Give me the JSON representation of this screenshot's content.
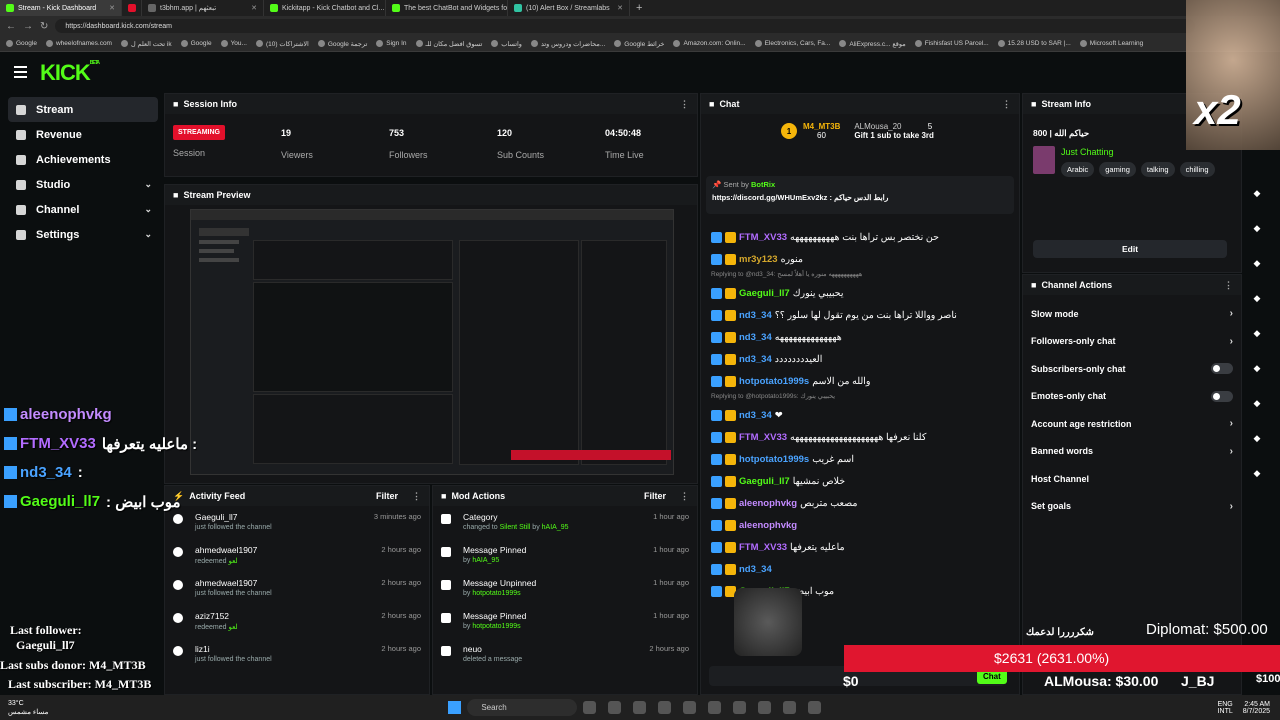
{
  "browser": {
    "tabs": [
      {
        "title": "Stream - Kick Dashboard",
        "color": "#53fc18",
        "active": true
      },
      {
        "title": "",
        "color": "#e3102b"
      },
      {
        "title": "t3bhm.app | تبعثهم",
        "color": "#666"
      },
      {
        "title": "Kickitapp - Kick Chatbot and Cl...",
        "color": "#53fc18"
      },
      {
        "title": "The best ChatBot and Widgets fo...",
        "color": "#53fc18"
      },
      {
        "title": "(10) Alert Box / Streamlabs",
        "color": "#31c3a2"
      }
    ],
    "url": "https://dashboard.kick.com/stream",
    "bookmarks": [
      "Google",
      "wheelofnames.com",
      "تحت العلم ل ik",
      "Google",
      "You...",
      "الاشتراكات (10)",
      "Google ترجمة",
      "Sign In",
      "تسوق افضل مكان للـ",
      "واتساب",
      "محاضرات ودروس وتد...",
      "Google خرائط",
      "Amazon.com: Onlin...",
      "Electronics, Cars, Fa...",
      "AliExpress.c... موقع",
      "Fishisfast US Parcel...",
      "15.28 USD to SAR |...",
      "Microsoft Learning"
    ]
  },
  "sidebar": {
    "logo": "KICK",
    "logo_badge": "BETA",
    "items": [
      {
        "label": "Stream",
        "icon": "stream-icon",
        "active": true
      },
      {
        "label": "Revenue",
        "icon": "revenue-icon"
      },
      {
        "label": "Achievements",
        "icon": "trophy-icon"
      },
      {
        "label": "Studio",
        "icon": "gear-icon",
        "chev": "⌄"
      },
      {
        "label": "Channel",
        "icon": "channel-icon",
        "chev": "⌄"
      },
      {
        "label": "Settings",
        "icon": "settings-icon",
        "chev": "⌄"
      }
    ]
  },
  "session": {
    "title": "Session Info",
    "status": "STREAMING",
    "status_label": "Session",
    "stats": [
      {
        "value": "19",
        "label": "Viewers"
      },
      {
        "value": "753",
        "label": "Followers"
      },
      {
        "value": "120",
        "label": "Sub Counts"
      },
      {
        "value": "04:50:48",
        "label": "Time Live"
      }
    ]
  },
  "preview": {
    "title": "Stream Preview"
  },
  "activity": {
    "title": "Activity Feed",
    "filter": "Filter",
    "items": [
      {
        "user": "Gaeguli_ll7",
        "sub": "just followed the channel",
        "time": "3 minutes ago",
        "kind": "follow"
      },
      {
        "user": "ahmedwael1907",
        "sub": "redeemed",
        "reward": "لعو",
        "time": "2 hours ago",
        "kind": "redeem"
      },
      {
        "user": "ahmedwael1907",
        "sub": "just followed the channel",
        "time": "2 hours ago",
        "kind": "follow"
      },
      {
        "user": "aziz7152",
        "sub": "redeemed",
        "reward": "لعو",
        "time": "2 hours ago",
        "kind": "redeem"
      },
      {
        "user": "liz1i",
        "sub": "just followed the channel",
        "time": "2 hours ago",
        "kind": "follow"
      }
    ]
  },
  "mod": {
    "title": "Mod Actions",
    "filter": "Filter",
    "items": [
      {
        "action": "Category",
        "detail": "changed to",
        "target": "Silent Still",
        "by": "by",
        "who": "hAIA_95",
        "time": "1 hour ago"
      },
      {
        "action": "Message Pinned",
        "detail": "",
        "target": "",
        "by": "by",
        "who": "hAIA_95",
        "time": "1 hour ago"
      },
      {
        "action": "Message Unpinned",
        "detail": "",
        "target": "",
        "by": "by",
        "who": "hotpotato1999s",
        "time": "1 hour ago"
      },
      {
        "action": "Message Pinned",
        "detail": "",
        "target": "",
        "by": "by",
        "who": "hotpotato1999s",
        "time": "1 hour ago"
      },
      {
        "action": "neuo",
        "detail": "deleted a message",
        "target": "",
        "by": "",
        "who": "",
        "time": "2 hours ago"
      }
    ]
  },
  "chat": {
    "title": "Chat",
    "gifter": {
      "name": "M4_MT3B",
      "count": "60",
      "rank": "1"
    },
    "gifter2": {
      "name": "ALMousa_20",
      "count": "5",
      "goal": "Gift 1 sub to take 3rd"
    },
    "pinned": {
      "sent_by": "Sent by",
      "bot": "BotRix",
      "text": "رابط الدس حياكم : https://discord.gg/WHUmExv2kz"
    },
    "messages": [
      {
        "name": "FTM_XV33",
        "color": "#b26cff",
        "text": "حن نختصر بس تراها بنت ههههههههههه",
        "reply": ""
      },
      {
        "name": "mr3y123",
        "color": "#d4a72c",
        "text": "منوره",
        "reply": ""
      },
      {
        "name": "Gaeguli_ll7",
        "color": "#53fc18",
        "text": "يحبيبي ينورك",
        "reply": "Replying to @nd3_34: ههههههههههه منوره يا أهلاً لمسح"
      },
      {
        "name": "nd3_34",
        "color": "#4aa3ff",
        "text": "ناصر وواللا تراها بنت من يوم تقول لها سلور ؟؟",
        "reply": ""
      },
      {
        "name": "nd3_34",
        "color": "#4aa3ff",
        "text": "ههههههههههههههه",
        "reply": ""
      },
      {
        "name": "nd3_34",
        "color": "#4aa3ff",
        "text": "العيدددددددد",
        "reply": ""
      },
      {
        "name": "hotpotato1999s",
        "color": "#4aa3ff",
        "text": "والله من الاسم",
        "reply": ""
      },
      {
        "name": "nd3_34",
        "color": "#4aa3ff",
        "text": "❤",
        "reply": "Replying to @hotpotato1999s: يحبيبي ينورك"
      },
      {
        "name": "FTM_XV33",
        "color": "#b26cff",
        "text": "كلنا نعرفها ههههههههههههههههههههه",
        "reply": ""
      },
      {
        "name": "hotpotato1999s",
        "color": "#4aa3ff",
        "text": "اسم غريب",
        "reply": ""
      },
      {
        "name": "Gaeguli_ll7",
        "color": "#53fc18",
        "text": "خلاص نمشيها",
        "reply": ""
      },
      {
        "name": "aleenophvkg",
        "color": "#c38bff",
        "text": "مصعب متربص",
        "reply": ""
      },
      {
        "name": "aleenophvkg",
        "color": "#c38bff",
        "text": "",
        "reply": ""
      },
      {
        "name": "FTM_XV33",
        "color": "#b26cff",
        "text": "ماعليه يتعرفها",
        "reply": ""
      },
      {
        "name": "nd3_34",
        "color": "#4aa3ff",
        "text": "",
        "reply": ""
      },
      {
        "name": "Gaeguli_ll7",
        "color": "#53fc18",
        "text": "موب ابيض",
        "reply": ""
      }
    ],
    "send": "Chat"
  },
  "streaminfo": {
    "title": "Stream Info",
    "stream_title": "800 | حياكم الله",
    "category": "Just Chatting",
    "tags": [
      "Arabic",
      "gaming",
      "talking",
      "chilling"
    ],
    "edit": "Edit"
  },
  "actions": {
    "title": "Channel Actions",
    "items": [
      {
        "label": "Slow mode",
        "type": "chev"
      },
      {
        "label": "Followers-only chat",
        "type": "chev"
      },
      {
        "label": "Subscribers-only chat",
        "type": "toggle"
      },
      {
        "label": "Emotes-only chat",
        "type": "toggle"
      },
      {
        "label": "Account age restriction",
        "type": "chev"
      },
      {
        "label": "Banned words",
        "type": "chev"
      },
      {
        "label": "Host Channel",
        "type": "none"
      },
      {
        "label": "Set goals",
        "type": "chev"
      }
    ]
  },
  "overlay": {
    "multiplier": "x2",
    "chat": [
      {
        "name": "aleenophvkg",
        "color": "#c38bff",
        "text": ""
      },
      {
        "name": "FTM_XV33",
        "color": "#b26cff",
        "text": "ماعليه يتعرفها :"
      },
      {
        "name": "nd3_34",
        "color": "#4aa3ff",
        "text": ":"
      },
      {
        "name": "Gaeguli_ll7",
        "color": "#53fc18",
        "text": ": موب ابيض"
      }
    ],
    "last_follower_label": "Last follower:",
    "last_follower": "Gaeguli_ll7",
    "last_donor": "Last subs donor: M4_MT3B",
    "last_sub": "Last subscriber: M4_MT3B",
    "thanks": "شكررررا لدعمك",
    "diplomat": "Diplomat: $500.00",
    "goal_text": "$2631 (2631.00%)",
    "goal_left": "$0",
    "almousa": "ALMousa: $30.00",
    "jb": "J_BJ",
    "right_val": "$100"
  },
  "taskbar": {
    "weather": "33°C",
    "weather_sub": "مساء مشمس",
    "search": "Search",
    "lang": "ENG",
    "lang2": "INTL",
    "time": "2:45 AM",
    "date": "8/7/2025"
  }
}
